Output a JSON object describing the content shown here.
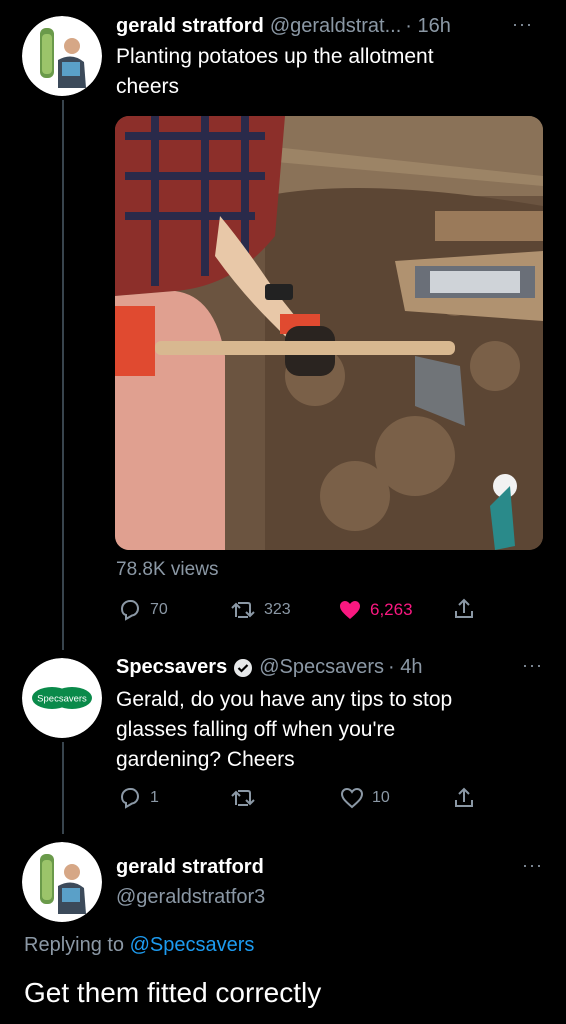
{
  "tweet1": {
    "name": "gerald stratford",
    "handle": "@geraldstrat...",
    "time": "· 16h",
    "text_line1": "Planting potatoes up the allotment",
    "text_line2": "cheers",
    "views": "78.8K views",
    "replies": "70",
    "retweets": "323",
    "likes": "6,263",
    "like_color": "#f91880"
  },
  "tweet2": {
    "name": "Specsavers",
    "handle": "@Specsavers",
    "time": "· 4h",
    "avatar_text": "Specsavers",
    "text_line1": "Gerald, do you have any tips to stop",
    "text_line2": "glasses falling off when you're",
    "text_line3": "gardening? Cheers",
    "replies": "1",
    "likes": "10",
    "brand_color": "#0a8a4a"
  },
  "tweet3": {
    "name": "gerald stratford",
    "handle": "@geraldstratfor3",
    "replying_prefix": "Replying to",
    "replying_to": "@Specsavers",
    "text": "Get them fitted correctly"
  },
  "icons": {
    "more": "more-icon",
    "reply": "reply-icon",
    "retweet": "retweet-icon",
    "like": "heart-icon",
    "share": "share-icon",
    "verified": "verified-badge-icon"
  }
}
